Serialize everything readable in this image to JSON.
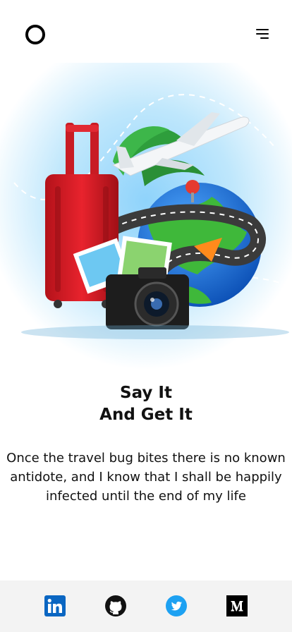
{
  "header": {
    "logo_icon": "ring-logo-icon",
    "menu_icon": "hamburger-menu-icon"
  },
  "hero": {
    "illustration": "travel-illustration"
  },
  "headline": {
    "line1": "Say It",
    "line2": "And Get It"
  },
  "description": "Once the travel bug bites there is no known antidote, and I know that I shall be happily infected until the end of my life",
  "footer": {
    "links": [
      {
        "icon": "linkedin-icon",
        "color": "#0a66c2"
      },
      {
        "icon": "github-icon",
        "color": "#111111"
      },
      {
        "icon": "twitter-icon",
        "color": "#1da1f2"
      },
      {
        "icon": "medium-icon",
        "color": "#000000"
      }
    ]
  }
}
